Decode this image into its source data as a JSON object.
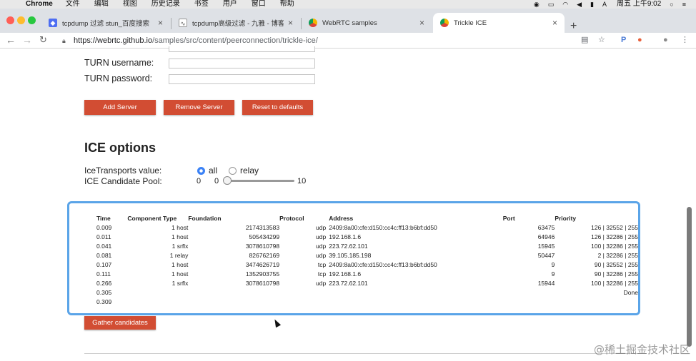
{
  "menubar": {
    "app": "Chrome",
    "items": [
      "文件",
      "编辑",
      "视图",
      "历史记录",
      "书签",
      "用户",
      "窗口",
      "帮助"
    ],
    "clock": "周五 上午9:02",
    "input_method": "A"
  },
  "tabs": [
    {
      "title": "tcpdump 过滤 stun_百度搜索",
      "favicon_color": "#4e6ef2"
    },
    {
      "title": "tcpdump高级过滤 - 九雅 - 博客",
      "favicon_color": "#888888"
    },
    {
      "title": "WebRTC samples",
      "favicon_color": "#f4b400"
    },
    {
      "title": "Trickle ICE",
      "favicon_color": "#f4b400",
      "active": true
    }
  ],
  "toolbar": {
    "url_host": "https://webrtc.github.io",
    "url_path": "/samples/src/content/peerconnection/trickle-ice/",
    "profile_letter": "P"
  },
  "form": {
    "turn_username_label": "TURN username:",
    "turn_password_label": "TURN password:",
    "turn_username_value": "",
    "turn_password_value": ""
  },
  "buttons": {
    "add_server": "Add Server",
    "remove_server": "Remove Server",
    "reset_defaults": "Reset to defaults",
    "gather": "Gather candidates"
  },
  "ice": {
    "heading": "ICE options",
    "transports_label": "IceTransports value:",
    "option_all": "all",
    "option_relay": "relay",
    "selected": "all",
    "pool_label": "ICE Candidate Pool:",
    "pool_value": "0",
    "pool_min": "0",
    "pool_max": "10"
  },
  "candidates": {
    "headers": [
      "Time",
      "Component",
      "Type",
      "Foundation",
      "Protocol",
      "Address",
      "Port",
      "Priority"
    ],
    "rows": [
      {
        "time": "0.009",
        "component": "1",
        "type": "host",
        "foundation": "2174313583",
        "protocol": "udp",
        "address": "2409:8a00:cfe:d150:cc4c:ff13:b6bf:dd50",
        "port": "63475",
        "priority": "126 | 32552 | 255"
      },
      {
        "time": "0.011",
        "component": "1",
        "type": "host",
        "foundation": "505434299",
        "protocol": "udp",
        "address": "192.168.1.6",
        "port": "64946",
        "priority": "126 | 32286 | 255"
      },
      {
        "time": "0.041",
        "component": "1",
        "type": "srflx",
        "foundation": "3078610798",
        "protocol": "udp",
        "address": "223.72.62.101",
        "port": "15945",
        "priority": "100 | 32286 | 255"
      },
      {
        "time": "0.081",
        "component": "1",
        "type": "relay",
        "foundation": "826762169",
        "protocol": "udp",
        "address": "39.105.185.198",
        "port": "50447",
        "priority": "2 | 32286 | 255"
      },
      {
        "time": "0.107",
        "component": "1",
        "type": "host",
        "foundation": "3474626719",
        "protocol": "tcp",
        "address": "2409:8a00:cfe:d150:cc4c:ff13:b6bf:dd50",
        "port": "9",
        "priority": "90 | 32552 | 255"
      },
      {
        "time": "0.111",
        "component": "1",
        "type": "host",
        "foundation": "1352903755",
        "protocol": "tcp",
        "address": "192.168.1.6",
        "port": "9",
        "priority": "90 | 32286 | 255"
      },
      {
        "time": "0.266",
        "component": "1",
        "type": "srflx",
        "foundation": "3078610798",
        "protocol": "udp",
        "address": "223.72.62.101",
        "port": "15944",
        "priority": "100 | 32286 | 255"
      },
      {
        "time": "0.305",
        "component": "",
        "type": "",
        "foundation": "",
        "protocol": "",
        "address": "",
        "port": "",
        "priority": "Done"
      },
      {
        "time": "0.309",
        "component": "",
        "type": "",
        "foundation": "",
        "protocol": "",
        "address": "",
        "port": "",
        "priority": ""
      }
    ]
  },
  "watermark": "@稀土掘金技术社区",
  "colors": {
    "button_red": "#d24d33",
    "box_border": "#5aa4e8",
    "radio_blue": "#3b82f6"
  }
}
